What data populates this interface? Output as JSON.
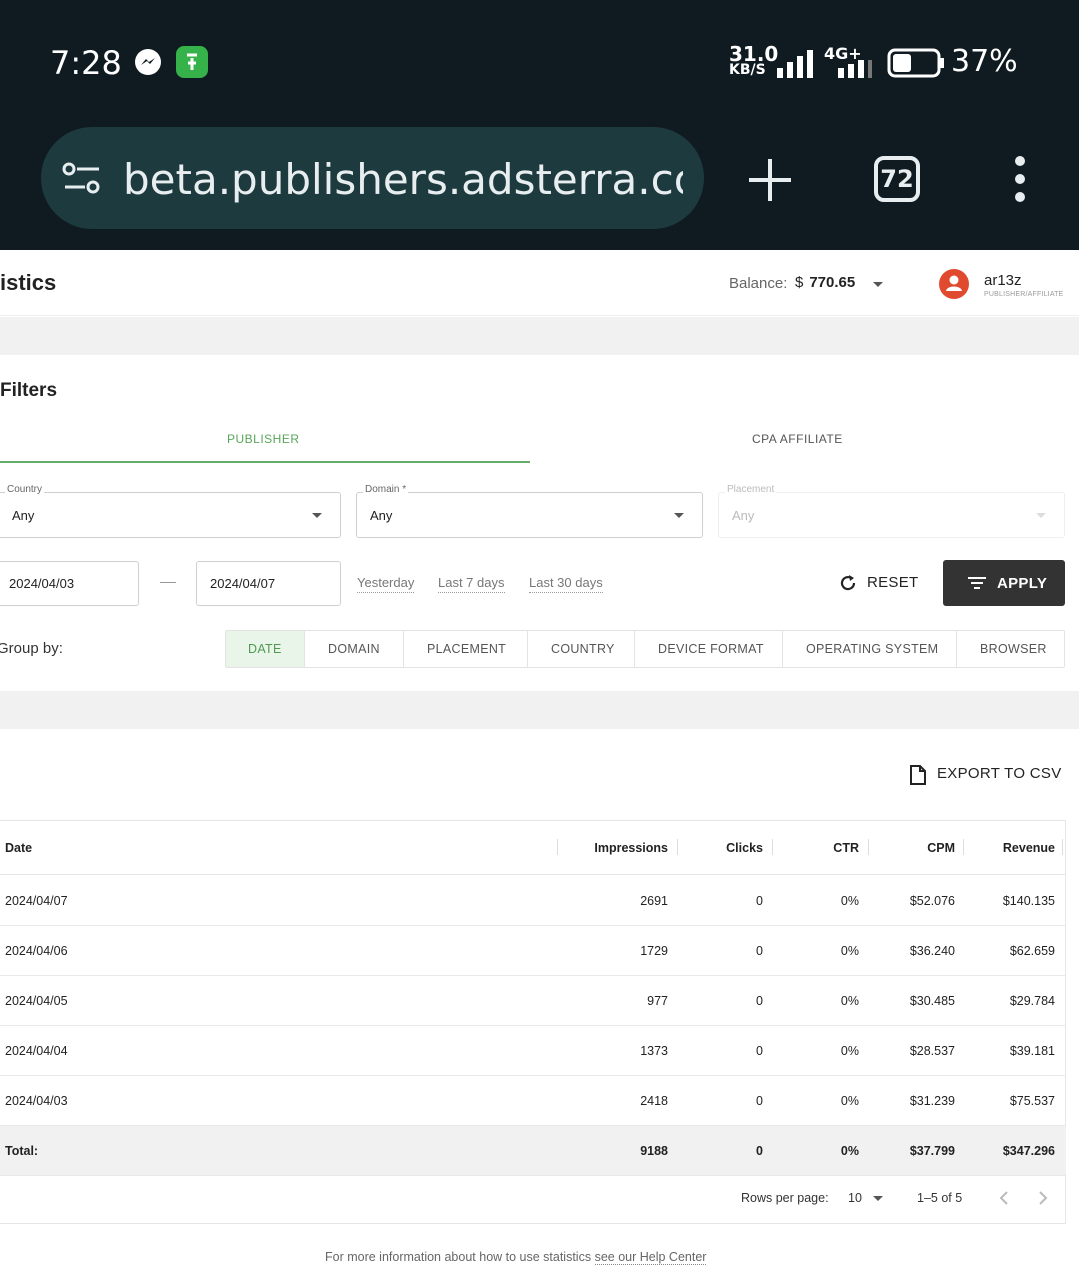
{
  "status_bar": {
    "time": "7:28",
    "net_speed": "31.0",
    "net_unit": "KB/S",
    "network_type": "4G+",
    "battery": "37%"
  },
  "browser": {
    "url": "beta.publishers.adsterra.com/s",
    "tab_count": "72"
  },
  "header": {
    "page_title": "istics",
    "balance_label": "Balance:",
    "currency": "$",
    "balance_value": "770.65",
    "user_name": "ar13z",
    "user_role": "PUBLISHER/AFFILIATE"
  },
  "filters": {
    "title": "Filters",
    "tabs": [
      "PUBLISHER",
      "CPA AFFILIATE"
    ],
    "country": {
      "label": "Country",
      "value": "Any"
    },
    "domain": {
      "label": "Domain *",
      "value": "Any"
    },
    "placement": {
      "label": "Placement",
      "value": "Any"
    },
    "date_from": "2024/04/03",
    "date_to": "2024/04/07",
    "quick_ranges": [
      "Yesterday",
      "Last 7 days",
      "Last 30 days"
    ],
    "reset_label": "RESET",
    "apply_label": "APPLY"
  },
  "group_by": {
    "label": "Group by:",
    "options": [
      "DATE",
      "DOMAIN",
      "PLACEMENT",
      "COUNTRY",
      "DEVICE FORMAT",
      "OPERATING SYSTEM",
      "BROWSER"
    ],
    "active": "DATE"
  },
  "export_label": "EXPORT TO CSV",
  "table": {
    "columns": [
      "Date",
      "Impressions",
      "Clicks",
      "CTR",
      "CPM",
      "Revenue"
    ],
    "rows": [
      [
        "2024/04/07",
        "2691",
        "0",
        "0%",
        "$52.076",
        "$140.135"
      ],
      [
        "2024/04/06",
        "1729",
        "0",
        "0%",
        "$36.240",
        "$62.659"
      ],
      [
        "2024/04/05",
        "977",
        "0",
        "0%",
        "$30.485",
        "$29.784"
      ],
      [
        "2024/04/04",
        "1373",
        "0",
        "0%",
        "$28.537",
        "$39.181"
      ],
      [
        "2024/04/03",
        "2418",
        "0",
        "0%",
        "$31.239",
        "$75.537"
      ]
    ],
    "total": [
      "Total:",
      "9188",
      "0",
      "0%",
      "$37.799",
      "$347.296"
    ]
  },
  "pagination": {
    "rows_per_page_label": "Rows per page:",
    "rows_per_page": "10",
    "range": "1–5 of 5"
  },
  "help": {
    "text": "For more information about how to use statistics",
    "link": "see our Help Center"
  },
  "colors": {
    "accent_green": "#57a55a",
    "apply_bg": "#333333",
    "avatar": "#e04a2f",
    "topbar": "#0f1b20"
  }
}
